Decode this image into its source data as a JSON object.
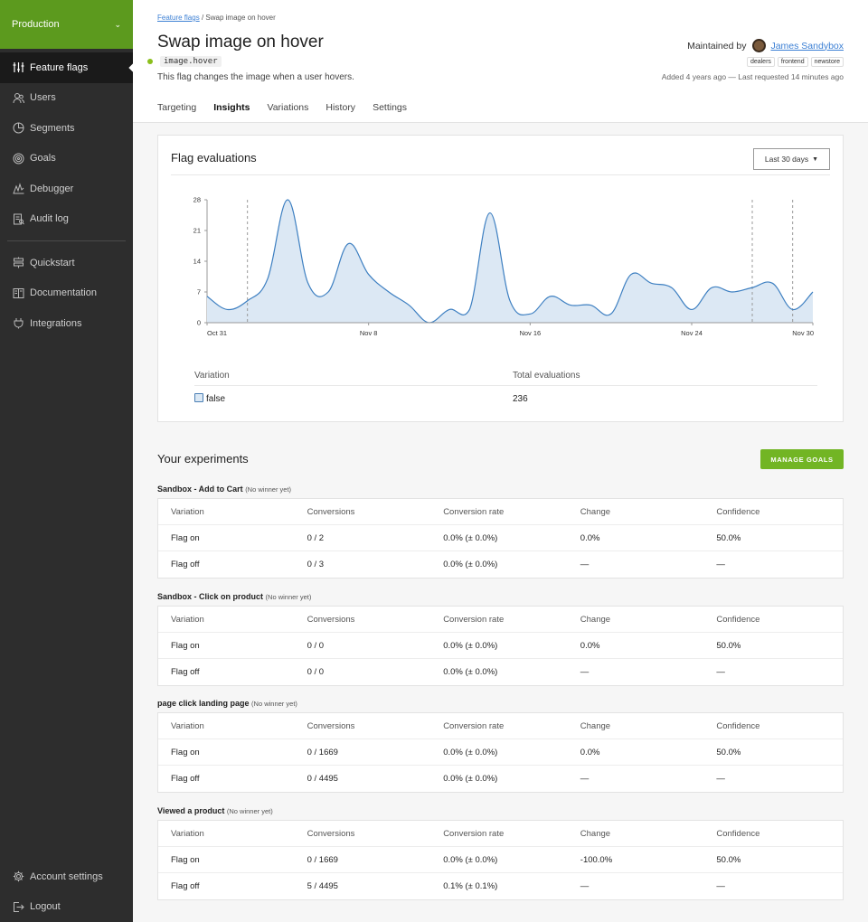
{
  "sidebar": {
    "environment": "Production",
    "items": [
      {
        "label": "Feature flags",
        "icon": "flag-sliders-icon"
      },
      {
        "label": "Users",
        "icon": "users-icon"
      },
      {
        "label": "Segments",
        "icon": "pie-icon"
      },
      {
        "label": "Goals",
        "icon": "target-icon"
      },
      {
        "label": "Debugger",
        "icon": "debugger-icon"
      },
      {
        "label": "Audit log",
        "icon": "audit-icon"
      }
    ],
    "items2": [
      {
        "label": "Quickstart",
        "icon": "signpost-icon"
      },
      {
        "label": "Documentation",
        "icon": "book-icon"
      },
      {
        "label": "Integrations",
        "icon": "plug-icon"
      }
    ],
    "bottom": [
      {
        "label": "Account settings",
        "icon": "gear-icon"
      },
      {
        "label": "Logout",
        "icon": "logout-icon"
      }
    ]
  },
  "header": {
    "breadcrumb_link": "Feature flags",
    "breadcrumb_current": "Swap image on hover",
    "title": "Swap image on hover",
    "flag_key": "image.hover",
    "description": "This flag changes the image when a user hovers.",
    "maintained_by_label": "Maintained by",
    "maintainer": "James Sandybox",
    "tags": [
      "dealers",
      "frontend",
      "newstore"
    ],
    "meta": "Added 4 years ago — Last requested 14 minutes ago",
    "tabs": [
      "Targeting",
      "Insights",
      "Variations",
      "History",
      "Settings"
    ],
    "active_tab": "Insights"
  },
  "evaluations": {
    "title": "Flag evaluations",
    "range_label": "Last 30 days",
    "col_variation": "Variation",
    "col_total": "Total evaluations",
    "rows": [
      {
        "variation": "false",
        "total": "236"
      }
    ]
  },
  "chart_data": {
    "type": "area",
    "x": [
      0,
      1,
      2,
      3,
      4,
      5,
      6,
      7,
      8,
      9,
      10,
      11,
      12,
      13,
      14,
      15,
      16,
      17,
      18,
      19,
      20,
      21,
      22,
      23,
      24,
      25,
      26,
      27,
      28,
      29,
      30
    ],
    "x_tick_labels": [
      {
        "x": 0,
        "label": "Oct 31"
      },
      {
        "x": 8,
        "label": "Nov 8"
      },
      {
        "x": 16,
        "label": "Nov 16"
      },
      {
        "x": 24,
        "label": "Nov 24"
      },
      {
        "x": 30,
        "label": "Nov 30"
      }
    ],
    "values": [
      6,
      3,
      5,
      10,
      28,
      9,
      7,
      18,
      11,
      7,
      4,
      0,
      3,
      3,
      25,
      5,
      2,
      6,
      4,
      4,
      2,
      11,
      9,
      8,
      3,
      8,
      7,
      8,
      9,
      3,
      7
    ],
    "yticks": [
      0,
      7,
      14,
      21,
      28
    ],
    "ylim": [
      0,
      28
    ],
    "dashed_markers": [
      2,
      27,
      29
    ],
    "color": "#3d7fc1",
    "fill": "#dce8f4"
  },
  "experiments": {
    "title": "Your experiments",
    "manage_goals_label": "MANAGE GOALS",
    "no_winner": "(No winner yet)",
    "columns": [
      "Variation",
      "Conversions",
      "Conversion rate",
      "Change",
      "Confidence"
    ],
    "list": [
      {
        "name": "Sandbox - Add to Cart",
        "rows": [
          [
            "Flag on",
            "0 / 2",
            "0.0% (± 0.0%)",
            "0.0%",
            "50.0%"
          ],
          [
            "Flag off",
            "0 / 3",
            "0.0% (± 0.0%)",
            "—",
            "—"
          ]
        ]
      },
      {
        "name": "Sandbox - Click on product",
        "rows": [
          [
            "Flag on",
            "0 / 0",
            "0.0% (± 0.0%)",
            "0.0%",
            "50.0%"
          ],
          [
            "Flag off",
            "0 / 0",
            "0.0% (± 0.0%)",
            "—",
            "—"
          ]
        ]
      },
      {
        "name": "page click landing page",
        "rows": [
          [
            "Flag on",
            "0 / 1669",
            "0.0% (± 0.0%)",
            "0.0%",
            "50.0%"
          ],
          [
            "Flag off",
            "0 / 4495",
            "0.0% (± 0.0%)",
            "—",
            "—"
          ]
        ]
      },
      {
        "name": "Viewed a product",
        "rows": [
          [
            "Flag on",
            "0 / 1669",
            "0.0% (± 0.0%)",
            "-100.0%",
            "50.0%"
          ],
          [
            "Flag off",
            "5 / 4495",
            "0.1% (± 0.1%)",
            "—",
            "—"
          ]
        ]
      }
    ]
  }
}
